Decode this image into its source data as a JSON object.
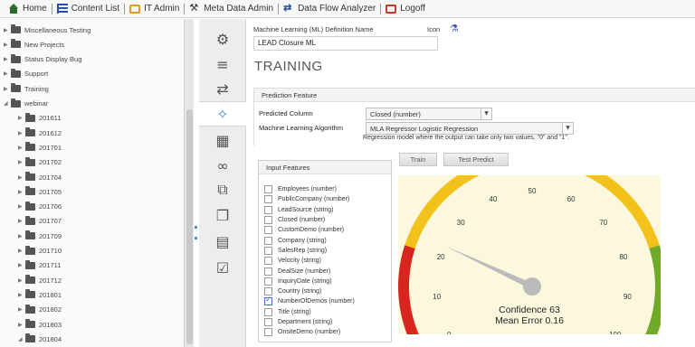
{
  "nav": {
    "items": [
      {
        "label": "Home",
        "icon": "home-icon"
      },
      {
        "label": "Content List",
        "icon": "list-icon"
      },
      {
        "label": "IT Admin",
        "icon": "admin-icon"
      },
      {
        "label": "Meta Data Admin",
        "icon": "metadata-icon"
      },
      {
        "label": "Data Flow Analyzer",
        "icon": "dataflow-icon"
      },
      {
        "label": "Logoff",
        "icon": "logoff-icon"
      }
    ]
  },
  "tree": {
    "items": [
      {
        "label": "Miscellaneous Testing",
        "expanded": false,
        "level": 0
      },
      {
        "label": "New Projects",
        "expanded": false,
        "level": 0
      },
      {
        "label": "Status Display Bug",
        "expanded": false,
        "level": 0
      },
      {
        "label": "Support",
        "expanded": false,
        "level": 0
      },
      {
        "label": "Training",
        "expanded": false,
        "level": 0
      },
      {
        "label": "webinar",
        "expanded": true,
        "level": 0
      },
      {
        "label": "201611",
        "expanded": false,
        "level": 1
      },
      {
        "label": "201612",
        "expanded": false,
        "level": 1
      },
      {
        "label": "201701",
        "expanded": false,
        "level": 1
      },
      {
        "label": "201702",
        "expanded": false,
        "level": 1
      },
      {
        "label": "201704",
        "expanded": false,
        "level": 1
      },
      {
        "label": "201705",
        "expanded": false,
        "level": 1
      },
      {
        "label": "201706",
        "expanded": false,
        "level": 1
      },
      {
        "label": "201707",
        "expanded": false,
        "level": 1
      },
      {
        "label": "201709",
        "expanded": false,
        "level": 1
      },
      {
        "label": "201710",
        "expanded": false,
        "level": 1
      },
      {
        "label": "201711",
        "expanded": false,
        "level": 1
      },
      {
        "label": "201712",
        "expanded": false,
        "level": 1
      },
      {
        "label": "201801",
        "expanded": false,
        "level": 1
      },
      {
        "label": "201802",
        "expanded": false,
        "level": 1
      },
      {
        "label": "201803",
        "expanded": false,
        "level": 1
      },
      {
        "label": "201804",
        "expanded": true,
        "level": 1
      }
    ]
  },
  "rail": {
    "items": [
      {
        "icon": "settings-gears-icon",
        "glyph": "⚙",
        "active": false
      },
      {
        "icon": "list-settings-icon",
        "glyph": "≡",
        "active": false
      },
      {
        "icon": "transfer-arrows-icon",
        "glyph": "⇄",
        "active": false
      },
      {
        "icon": "magic-wand-icon",
        "glyph": "✧",
        "active": true
      },
      {
        "icon": "calendar-icon",
        "glyph": "▦",
        "active": false
      },
      {
        "icon": "link-icon",
        "glyph": "∞",
        "active": false
      },
      {
        "icon": "hierarchy-icon",
        "glyph": "⧉",
        "active": false
      },
      {
        "icon": "copy-icon",
        "glyph": "❐",
        "active": false
      },
      {
        "icon": "document-edit-icon",
        "glyph": "▤",
        "active": false
      },
      {
        "icon": "checklist-icon",
        "glyph": "☑",
        "active": false
      }
    ]
  },
  "definition": {
    "label": "Machine Learning (ML) Definition Name",
    "icon_label": "Icon",
    "name_value": "LEAD Closure ML"
  },
  "page_title": "TRAINING",
  "prediction": {
    "header": "Prediction Feature",
    "predicted_column_label": "Predicted Column",
    "predicted_column_value": "Closed (number)",
    "algorithm_label": "Machine Learning Algorithm",
    "algorithm_value": "MLA Regressor Logistic Regression",
    "help_text": "Regression model where the output can take only two values, \"0\" and \"1\"."
  },
  "buttons": {
    "train": "Train",
    "test_predict": "Test Predict"
  },
  "input_features": {
    "header": "Input Features",
    "items": [
      {
        "label": "Employees (number)",
        "checked": false
      },
      {
        "label": "PublicCompany (number)",
        "checked": false
      },
      {
        "label": "LeadSource (string)",
        "checked": false
      },
      {
        "label": "Closed (number)",
        "checked": false
      },
      {
        "label": "CustomDemo (number)",
        "checked": false
      },
      {
        "label": "Company (string)",
        "checked": false
      },
      {
        "label": "SalesRep (string)",
        "checked": false
      },
      {
        "label": "Velocity (string)",
        "checked": false
      },
      {
        "label": "DealSize (number)",
        "checked": false
      },
      {
        "label": "InquiryDate (string)",
        "checked": false
      },
      {
        "label": "Country (string)",
        "checked": false
      },
      {
        "label": "NumberOfDemos (number)",
        "checked": true
      },
      {
        "label": "Title (string)",
        "checked": false
      },
      {
        "label": "Department (string)",
        "checked": false
      },
      {
        "label": "OnsiteDemo (number)",
        "checked": false
      }
    ]
  },
  "gauge": {
    "min": 0,
    "max": 100,
    "value": 63,
    "ticks": [
      "0",
      "10",
      "20",
      "30",
      "40",
      "50",
      "60",
      "70",
      "80",
      "90",
      "100"
    ],
    "confidence_text": "Confidence 63",
    "mean_error_text": "Mean Error 0.16",
    "colors": {
      "low": "#d7261e",
      "mid": "#f2c21b",
      "high": "#6faa2a",
      "needle": "#bbbbbb",
      "background": "#fcf8dd"
    }
  }
}
